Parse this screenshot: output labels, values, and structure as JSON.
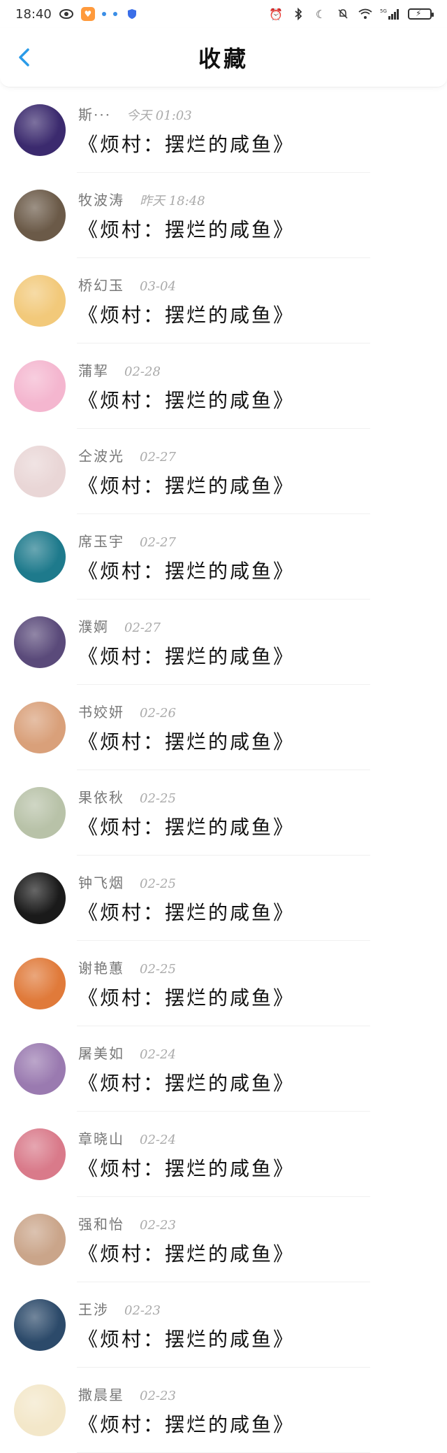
{
  "status": {
    "time": "18:40",
    "network": "5G",
    "app_badge": "♥"
  },
  "header": {
    "title": "收藏",
    "back_icon": "chevron-left-icon"
  },
  "colors": {
    "accent": "#2a9be8",
    "divider": "#f0f0f0"
  },
  "items": [
    {
      "name": "斯···",
      "time": "今天 01:03",
      "title": "《烦村：摆烂的咸鱼》",
      "avatar_color": "#3b2a6e"
    },
    {
      "name": "牧波涛",
      "time": "昨天 18:48",
      "title": "《烦村：摆烂的咸鱼》",
      "avatar_color": "#6b5a48"
    },
    {
      "name": "桥幻玉",
      "time": "03-04",
      "title": "《烦村：摆烂的咸鱼》",
      "avatar_color": "#f2c97a"
    },
    {
      "name": "蒲挈",
      "time": "02-28",
      "title": "《烦村：摆烂的咸鱼》",
      "avatar_color": "#f4b6cf"
    },
    {
      "name": "仝波光",
      "time": "02-27",
      "title": "《烦村：摆烂的咸鱼》",
      "avatar_color": "#e9d6d6"
    },
    {
      "name": "席玉宇",
      "time": "02-27",
      "title": "《烦村：摆烂的咸鱼》",
      "avatar_color": "#1e7a8c"
    },
    {
      "name": "濮婀",
      "time": "02-27",
      "title": "《烦村：摆烂的咸鱼》",
      "avatar_color": "#5a4a7a"
    },
    {
      "name": "书姣妍",
      "time": "02-26",
      "title": "《烦村：摆烂的咸鱼》",
      "avatar_color": "#d9a07a"
    },
    {
      "name": "果依秋",
      "time": "02-25",
      "title": "《烦村：摆烂的咸鱼》",
      "avatar_color": "#b8c2a8"
    },
    {
      "name": "钟飞烟",
      "time": "02-25",
      "title": "《烦村：摆烂的咸鱼》",
      "avatar_color": "#1a1a1a"
    },
    {
      "name": "谢艳蕙",
      "time": "02-25",
      "title": "《烦村：摆烂的咸鱼》",
      "avatar_color": "#e07a3a"
    },
    {
      "name": "屠美如",
      "time": "02-24",
      "title": "《烦村：摆烂的咸鱼》",
      "avatar_color": "#9a7ab0"
    },
    {
      "name": "章晓山",
      "time": "02-24",
      "title": "《烦村：摆烂的咸鱼》",
      "avatar_color": "#d97a8a"
    },
    {
      "name": "强和怡",
      "time": "02-23",
      "title": "《烦村：摆烂的咸鱼》",
      "avatar_color": "#caa58a"
    },
    {
      "name": "王涉",
      "time": "02-23",
      "title": "《烦村：摆烂的咸鱼》",
      "avatar_color": "#2c4a6a"
    },
    {
      "name": "撒晨星",
      "time": "02-23",
      "title": "《烦村：摆烂的咸鱼》",
      "avatar_color": "#f3e7c9"
    }
  ]
}
